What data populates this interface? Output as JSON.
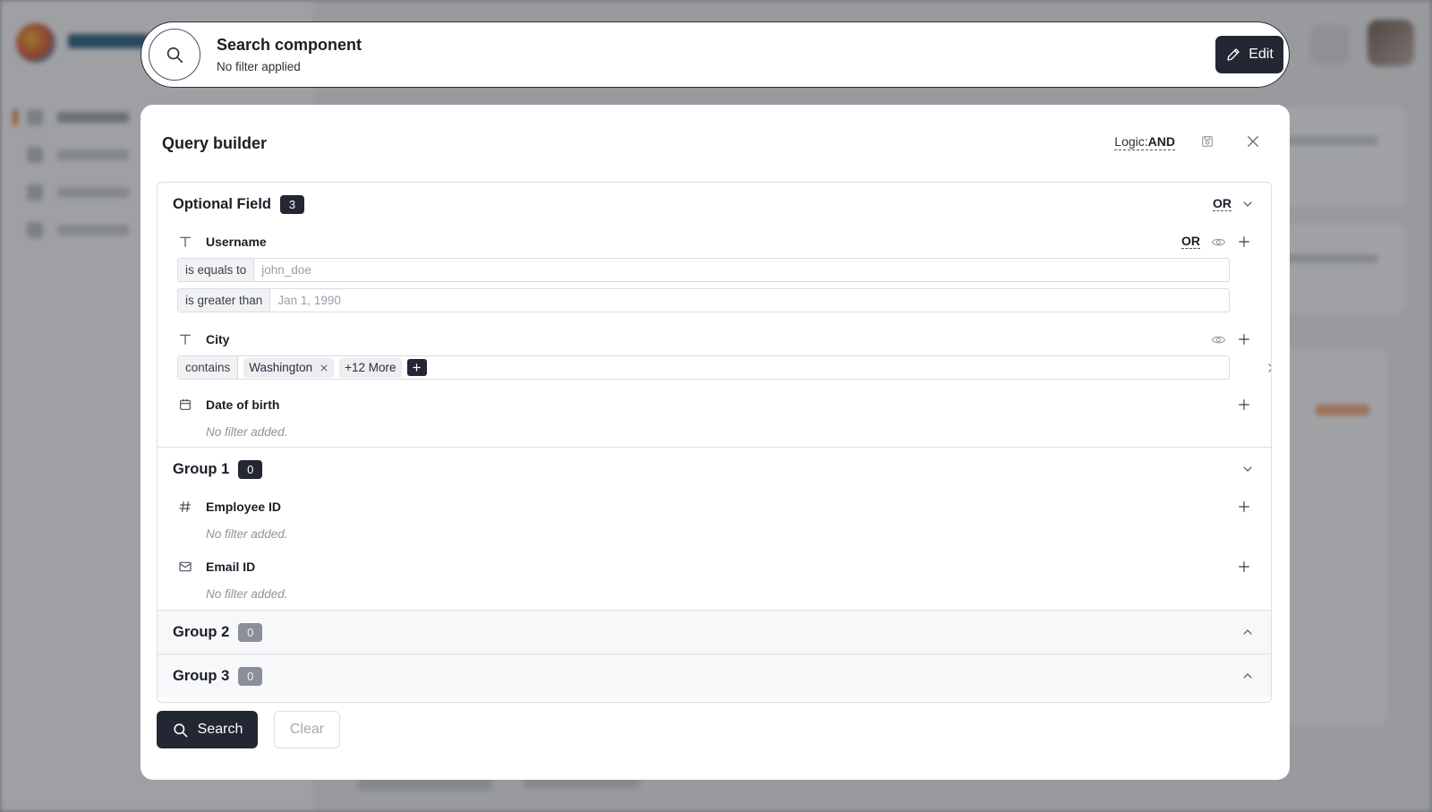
{
  "search_bar": {
    "title": "Search component",
    "subtitle": "No filter applied",
    "edit_label": "Edit"
  },
  "modal": {
    "title": "Query builder",
    "logic_label": "Logic:",
    "logic_value": "AND",
    "search_label": "Search",
    "clear_label": "Clear"
  },
  "optional": {
    "name": "Optional Field",
    "count": "3",
    "operator": "OR",
    "fields": {
      "username": {
        "name": "Username",
        "operator": "OR",
        "conditions": [
          {
            "op": "is equals to",
            "value": "john_doe"
          },
          {
            "op": "is greater than",
            "value": "Jan 1, 1990"
          }
        ]
      },
      "city": {
        "name": "City",
        "op": "contains",
        "chip": "Washington",
        "more": "+12 More"
      },
      "dob": {
        "name": "Date of birth",
        "empty": "No filter added."
      }
    }
  },
  "group1": {
    "name": "Group 1",
    "count": "0",
    "fields": {
      "employee": {
        "name": "Employee ID",
        "empty": "No filter added."
      },
      "email": {
        "name": "Email ID",
        "empty": "No filter added."
      }
    }
  },
  "group2": {
    "name": "Group 2",
    "count": "0"
  },
  "group3": {
    "name": "Group 3",
    "count": "0"
  },
  "icons": [
    "search-icon",
    "pencil-icon",
    "save-icon",
    "close-icon",
    "text-type-icon",
    "eye-icon",
    "plus-icon",
    "calendar-icon",
    "hash-icon",
    "mail-icon",
    "chevron-down-icon",
    "chevron-up-icon"
  ],
  "colors": {
    "primary": "#232733",
    "muted_badge": "#8a8f9a",
    "border": "#dcdee3"
  }
}
